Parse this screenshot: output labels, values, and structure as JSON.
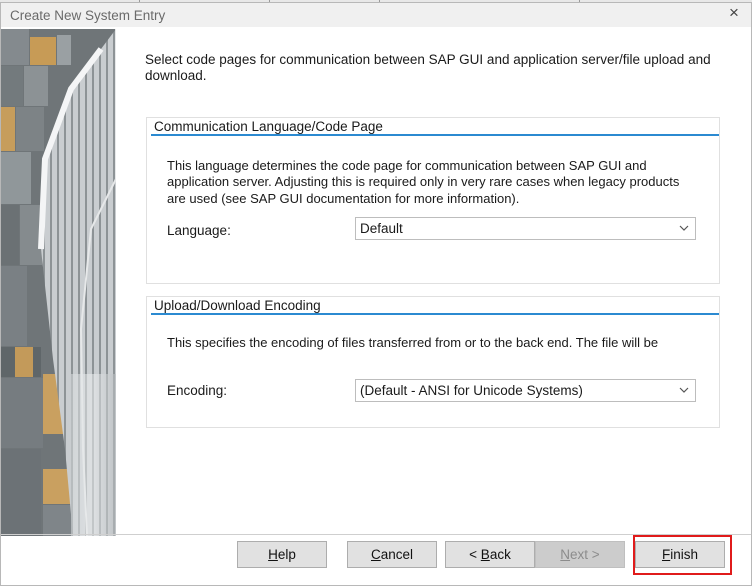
{
  "dialog": {
    "title": "Create New System Entry",
    "close_glyph": "×",
    "intro": "Select code pages for communication between SAP GUI and application server/file upload and download."
  },
  "communication": {
    "title": "Communication Language/Code Page",
    "description": "This language determines the code page for communication between SAP GUI and application server. Adjusting this is required only in very rare cases when legacy products are used (see SAP GUI documentation for more information).",
    "language_label": "Language:",
    "language_value": "Default"
  },
  "upload": {
    "title": "Upload/Download Encoding",
    "description": "This specifies the encoding of files transferred from or to the back end. The file will be",
    "encoding_label": "Encoding:",
    "encoding_value": "(Default - ANSI for Unicode Systems)"
  },
  "buttons": {
    "help": {
      "mnemonic": "H",
      "rest": "elp"
    },
    "cancel": {
      "mnemonic": "C",
      "rest": "ancel"
    },
    "back": {
      "prefix": "< ",
      "mnemonic": "B",
      "rest": "ack"
    },
    "next": {
      "mnemonic": "N",
      "rest": "ext >"
    },
    "finish": {
      "mnemonic": "F",
      "rest": "inish"
    }
  },
  "colors": {
    "group_underline": "#2b8ad1",
    "highlight": "#e01b1b",
    "button_face": "#e1e1e1"
  },
  "icons": [
    "close-icon",
    "chevron-down-icon"
  ]
}
